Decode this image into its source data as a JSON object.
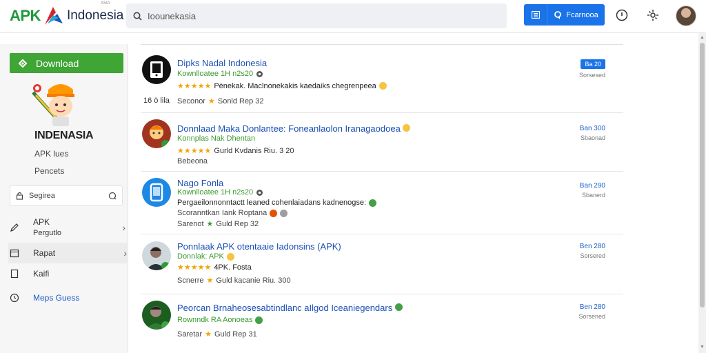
{
  "header": {
    "logo_apk": "APK",
    "logo_indonesia": "Indonesia",
    "logo_small": "ASIA",
    "search_placeholder": "Ioounekasia",
    "featured_label": "Fcarnooa"
  },
  "sidebar": {
    "download_label": "Download",
    "brand_name": "INDENASIA",
    "sub1": "APK lues",
    "sub2": "Pencets",
    "search_label": "Segirea",
    "items": [
      {
        "label": "APK",
        "sub": "Pergutlo"
      },
      {
        "label": "Rapat"
      },
      {
        "label": "Kaifi"
      },
      {
        "label": "Meps Guess"
      }
    ]
  },
  "apps": [
    {
      "title": "Dipks Nadal Indonesia",
      "line2": "Kownlloatee 1H n2s20",
      "line3": "Pènekak. Maclnonekakis kaedaiks chegrenpeea",
      "line4_left": "16 ö lila",
      "line4": "Seconor",
      "line4b": "Sonld Rep 32",
      "badge": "Ba 20",
      "stat": "Sorsesed"
    },
    {
      "title": "Donnlaad Maka Donlantee: Foneanlaolon Iranagaodoea",
      "line2": "Konnplas Nak Dhentan",
      "line3": "Gurld Kvdanis Riu. 3 20",
      "line4": "Bebeona",
      "size": "Ban 300",
      "stat": "Sbaonad"
    },
    {
      "title": "Nago Fonla",
      "line2": "Kownlloatee 1H n2s20",
      "line3": "Pergaeilonnonntactt leaned cohenlaiadans kadnenogse:",
      "line4": "Scoranntkan Iank Roptana",
      "line5": "Sarenot",
      "line5b": "Guld Rep 32",
      "size": "Ban 290",
      "stat": "Sbanerd"
    },
    {
      "title": "Ponnlaak APK otentaaie Iadonsins (APK)",
      "line2": "Donnlak: APK",
      "line3": "4PK. Fosta",
      "line4": "Scnerre",
      "line4b": "Guld kacanie Riu. 300",
      "size": "Ben 280",
      "stat": "Sorsered"
    },
    {
      "title": "Peorcan Brnaheosesabtindlanc aIlgod Iceaniegendars",
      "line2": "Rownndk RA Aonoeas",
      "line4": "Saretar",
      "line4b": "Guld Rep 31",
      "size": "Ben 280",
      "stat": "Sorsened"
    }
  ],
  "colors": {
    "accent_green": "#3fa535",
    "accent_blue": "#1a73e8",
    "link_blue": "#1a4fb5",
    "star": "#f0a500"
  },
  "icons": [
    "search-icon",
    "list-icon",
    "badge-icon",
    "info-icon",
    "settings-icon",
    "avatar",
    "download-icon",
    "edit-icon",
    "calendar-icon",
    "clock-icon",
    "chevron-right-icon"
  ]
}
